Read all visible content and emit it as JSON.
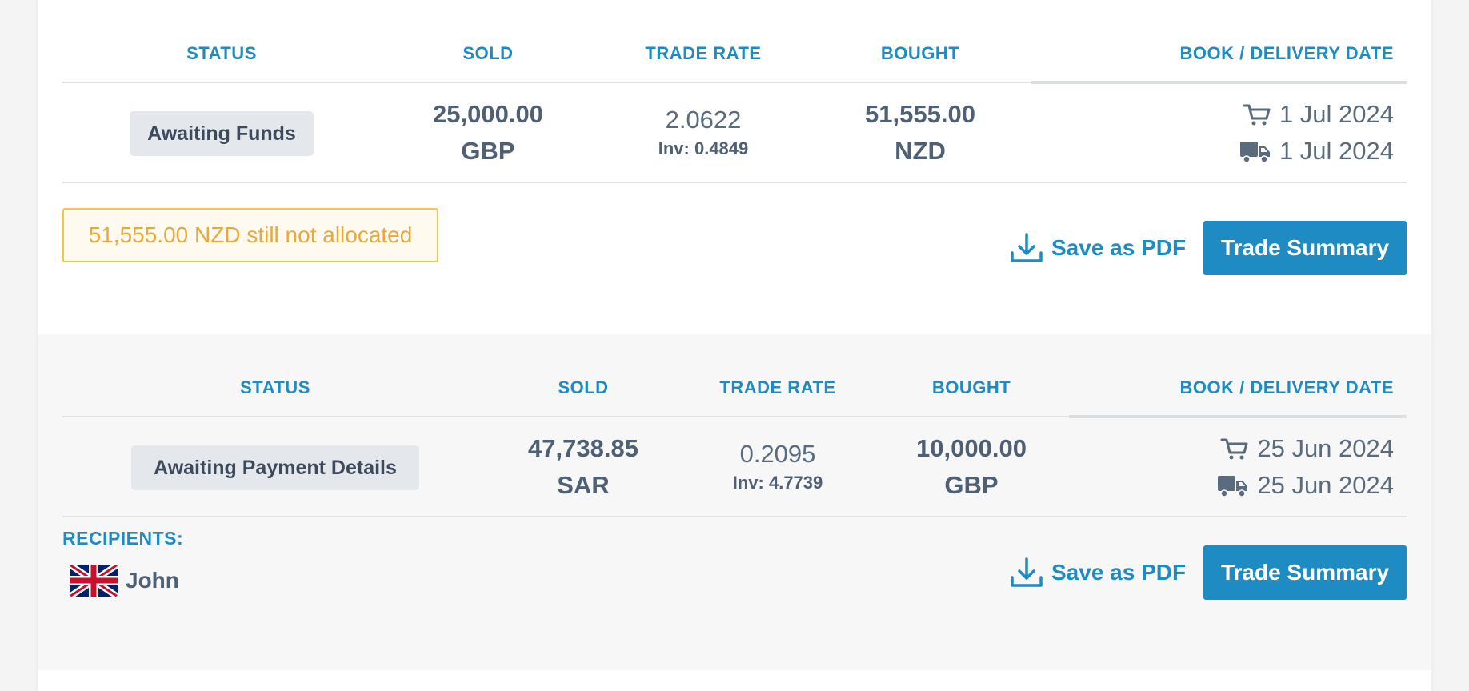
{
  "headers": {
    "status": "STATUS",
    "sold": "SOLD",
    "trade_rate": "TRADE RATE",
    "bought": "BOUGHT",
    "date": "BOOK / DELIVERY DATE"
  },
  "trades": [
    {
      "status": "Awaiting Funds",
      "sold_amount": "25,000.00",
      "sold_ccy": "GBP",
      "rate": "2.0622",
      "inv": "Inv: 0.4849",
      "bought_amount": "51,555.00",
      "bought_ccy": "NZD",
      "book_date": "1 Jul 2024",
      "delivery_date": "1 Jul 2024",
      "alert": "51,555.00 NZD still not allocated",
      "save_pdf": "Save as PDF",
      "summary": "Trade Summary"
    },
    {
      "status": "Awaiting Payment Details",
      "sold_amount": "47,738.85",
      "sold_ccy": "SAR",
      "rate": "0.2095",
      "inv": "Inv: 4.7739",
      "bought_amount": "10,000.00",
      "bought_ccy": "GBP",
      "book_date": "25 Jun 2024",
      "delivery_date": "25 Jun 2024",
      "recipients_label": "RECIPIENTS:",
      "recipient_name": "John",
      "recipient_flag": "uk-flag-icon",
      "save_pdf": "Save as PDF",
      "summary": "Trade Summary"
    }
  ],
  "colors": {
    "accent": "#1e8bc3",
    "warning": "#e9a83a",
    "text": "#5a6b7e"
  }
}
